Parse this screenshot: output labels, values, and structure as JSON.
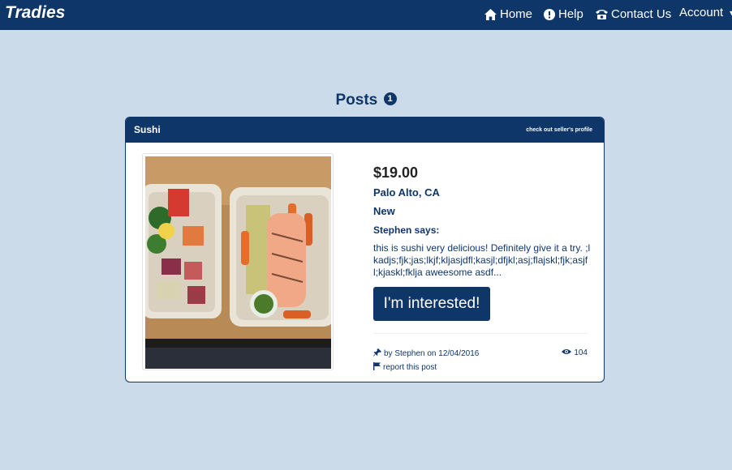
{
  "navbar": {
    "brand": "Tradies",
    "items": [
      {
        "label": "Home",
        "icon": "home-icon"
      },
      {
        "label": "Help",
        "icon": "info-icon"
      },
      {
        "label": "Contact Us",
        "icon": "phone-icon"
      },
      {
        "label": "Account",
        "icon": "caret-down-icon"
      }
    ]
  },
  "posts": {
    "heading": "Posts",
    "count": "1"
  },
  "post": {
    "title": "Sushi",
    "profile_link": "check out seller's profile",
    "price": "$19.00",
    "location": "Palo Alto, CA",
    "condition": "New",
    "seller_says": "Stephen says:",
    "description": "this is sushi very delicious! Definitely give it a try. ;lkadjs;fjk;jas;lkjf;kljasjdfl;kasjl;dfjkl;asj;flajskl;fjk;asjfl;kjaskl;fklja aweesome asdf...",
    "button_label": "I'm interested!",
    "byline": "by Stephen on 12/04/2016",
    "views": "104",
    "report_label": "report this post"
  },
  "colors": {
    "brand_navy": "#0f3668",
    "page_background": "#cbdbe9"
  }
}
